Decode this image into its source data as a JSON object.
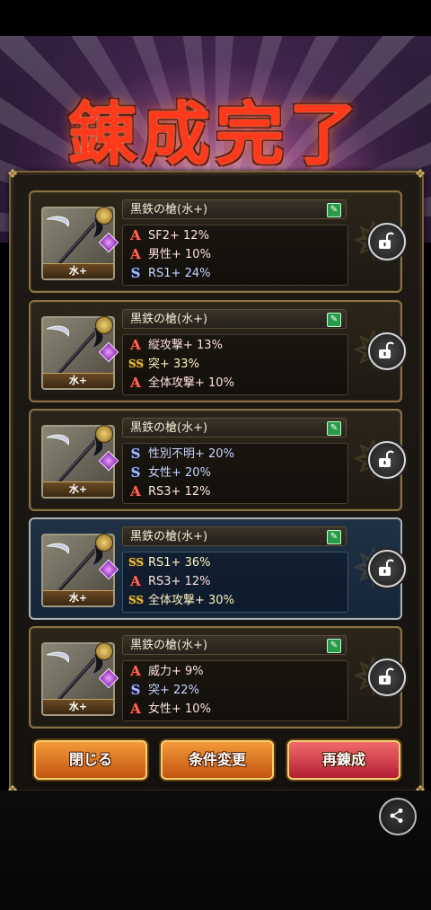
{
  "title": "錬成完了",
  "cards": [
    {
      "name": "黒鉄の槍(水+)",
      "element_badge": "水+",
      "highlighted": false,
      "stats": [
        {
          "icon": "A",
          "kind": "a",
          "text": "SF2+ 12%"
        },
        {
          "icon": "A",
          "kind": "a",
          "text": "男性+ 10%"
        },
        {
          "icon": "S",
          "kind": "s",
          "text": "RS1+ 24%"
        }
      ]
    },
    {
      "name": "黒鉄の槍(水+)",
      "element_badge": "水+",
      "highlighted": false,
      "stats": [
        {
          "icon": "A",
          "kind": "a",
          "text": "縦攻撃+ 13%"
        },
        {
          "icon": "SS",
          "kind": "ss",
          "text": "突+ 33%"
        },
        {
          "icon": "A",
          "kind": "a",
          "text": "全体攻撃+ 10%"
        }
      ]
    },
    {
      "name": "黒鉄の槍(水+)",
      "element_badge": "水+",
      "highlighted": false,
      "stats": [
        {
          "icon": "S",
          "kind": "s",
          "text": "性別不明+ 20%"
        },
        {
          "icon": "S",
          "kind": "s",
          "text": "女性+ 20%"
        },
        {
          "icon": "A",
          "kind": "a",
          "text": "RS3+ 12%"
        }
      ]
    },
    {
      "name": "黒鉄の槍(水+)",
      "element_badge": "水+",
      "highlighted": true,
      "stats": [
        {
          "icon": "SS",
          "kind": "ss",
          "text": "RS1+ 36%"
        },
        {
          "icon": "A",
          "kind": "a",
          "text": "RS3+ 12%"
        },
        {
          "icon": "SS",
          "kind": "ss",
          "text": "全体攻撃+ 30%"
        }
      ]
    },
    {
      "name": "黒鉄の槍(水+)",
      "element_badge": "水+",
      "highlighted": false,
      "stats": [
        {
          "icon": "A",
          "kind": "a",
          "text": "威力+ 9%"
        },
        {
          "icon": "S",
          "kind": "s",
          "text": "突+ 22%"
        },
        {
          "icon": "A",
          "kind": "a",
          "text": "女性+ 10%"
        }
      ]
    }
  ],
  "buttons": {
    "close": "閉じる",
    "change_conditions": "条件変更",
    "reforge": "再錬成"
  },
  "colors": {
    "title": "#ff3a1c",
    "button_orange": "#e07a24",
    "button_red": "#d6404a",
    "highlight_card": "#1c2c40"
  },
  "icons": {
    "lock": "unlock-icon",
    "edit": "edit-icon",
    "share": "share-icon"
  }
}
